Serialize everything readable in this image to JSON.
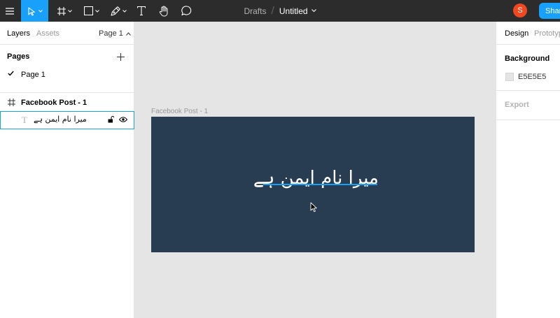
{
  "toolbar": {
    "breadcrumb": "Drafts",
    "separator": "/",
    "doc_title": "Untitled",
    "avatar_initial": "S",
    "share_label": "Share"
  },
  "left_panel": {
    "tabs": [
      "Layers",
      "Assets"
    ],
    "current_page": "Page 1",
    "pages_header": "Pages",
    "pages": [
      "Page 1"
    ],
    "layers": {
      "frame": "Facebook Post - 1",
      "text_layer": "میرا نام ایمن ہے"
    }
  },
  "canvas": {
    "frame_label": "Facebook Post - 1",
    "text_content": "میرا نام ایمن ہے",
    "frame_color": "#283c52",
    "canvas_color": "#e5e5e5",
    "accent": "#18a0fb"
  },
  "right_panel": {
    "tabs": [
      "Design",
      "Prototype"
    ],
    "background_header": "Background",
    "background_hex": "E5E5E5",
    "export_header": "Export"
  }
}
